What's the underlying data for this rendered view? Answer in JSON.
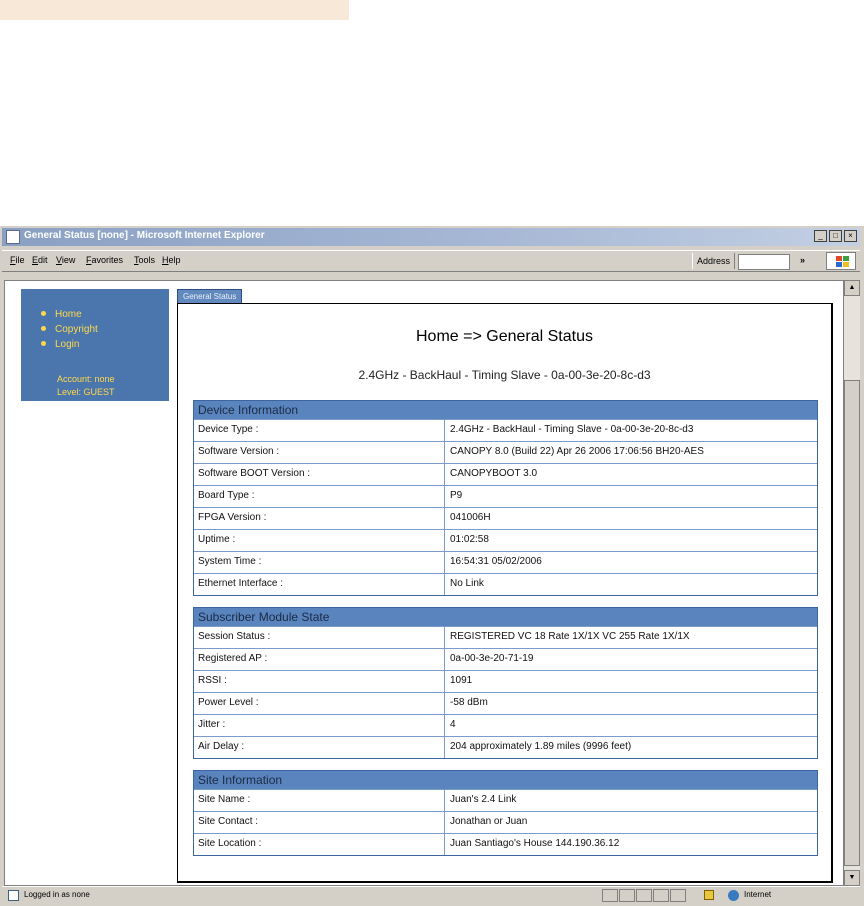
{
  "window": {
    "title": "General Status [none] - Microsoft Internet Explorer",
    "minimize": "_",
    "maximize": "□",
    "close": "×"
  },
  "menubar": {
    "items": [
      "File",
      "Edit",
      "View",
      "Favorites",
      "Tools",
      "Help"
    ],
    "address_label": "Address",
    "more_chevron": "»"
  },
  "nav": {
    "items": [
      "Home",
      "Copyright",
      "Login"
    ],
    "account_line": "Account: none",
    "level_line": "Level: GUEST"
  },
  "tab_label": "General Status",
  "page": {
    "title": "Home => General Status",
    "subtitle": "2.4GHz - BackHaul - Timing Slave - 0a-00-3e-20-8c-d3"
  },
  "sections": [
    {
      "header": "Device Information",
      "rows": [
        {
          "label": "Device Type :",
          "value": "2.4GHz - BackHaul - Timing Slave - 0a-00-3e-20-8c-d3"
        },
        {
          "label": "Software Version :",
          "value": "CANOPY 8.0 (Build 22) Apr 26 2006 17:06:56 BH20-AES"
        },
        {
          "label": "Software BOOT Version :",
          "value": "CANOPYBOOT 3.0"
        },
        {
          "label": "Board Type :",
          "value": "P9"
        },
        {
          "label": "FPGA Version :",
          "value": "041006H"
        },
        {
          "label": "Uptime :",
          "value": "01:02:58"
        },
        {
          "label": "System Time :",
          "value": "16:54:31 05/02/2006"
        },
        {
          "label": "Ethernet Interface :",
          "value": "No Link"
        }
      ]
    },
    {
      "header": "Subscriber Module State",
      "rows": [
        {
          "label": "Session Status :",
          "value": "REGISTERED VC 18 Rate 1X/1X VC 255 Rate 1X/1X"
        },
        {
          "label": "Registered AP :",
          "value": "0a-00-3e-20-71-19"
        },
        {
          "label": "RSSI :",
          "value": "1091"
        },
        {
          "label": "Power Level :",
          "value": "-58 dBm"
        },
        {
          "label": "Jitter :",
          "value": "4"
        },
        {
          "label": "Air Delay :",
          "value": "204 approximately 1.89 miles (9996 feet)"
        }
      ]
    },
    {
      "header": "Site Information",
      "rows": [
        {
          "label": "Site Name :",
          "value": "Juan's 2.4 Link"
        },
        {
          "label": "Site Contact :",
          "value": "Jonathan or Juan"
        },
        {
          "label": "Site Location :",
          "value": "Juan Santiago's House 144.190.36.12"
        }
      ]
    }
  ],
  "statusbar": {
    "text": "Logged in as none",
    "zone": "Internet"
  }
}
